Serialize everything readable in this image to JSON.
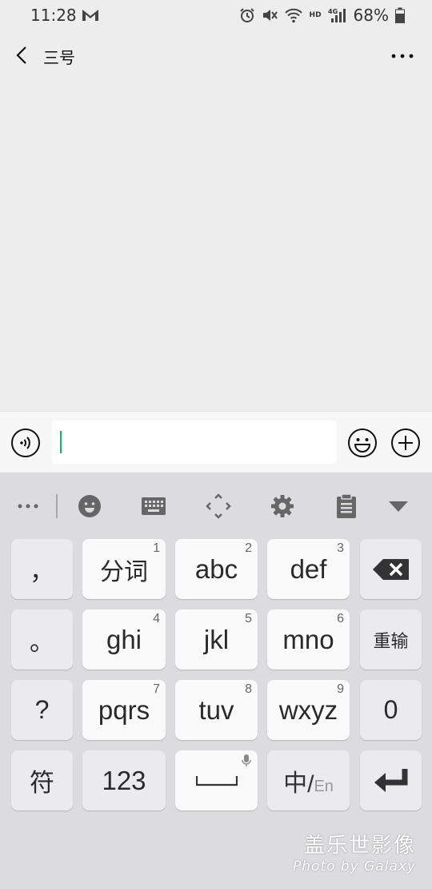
{
  "status_bar": {
    "time": "11:28",
    "battery": "68%",
    "hd_label": "HD",
    "network_label": "4G",
    "icons": [
      "gmail-icon",
      "alarm-icon",
      "mute-icon",
      "wifi-icon",
      "signal-icon",
      "battery-icon"
    ]
  },
  "header": {
    "title": "三号",
    "back_icon": "chevron-left-icon",
    "more_icon": "more-horizontal-icon"
  },
  "input_bar": {
    "value": "",
    "voice_icon": "voice-input-icon",
    "emoji_icon": "emoji-icon",
    "plus_icon": "plus-circle-icon"
  },
  "keyboard": {
    "toolbar_icons": [
      "more-icon",
      "emoji-icon",
      "keyboard-icon",
      "cursor-move-icon",
      "settings-icon",
      "clipboard-icon",
      "collapse-icon"
    ],
    "rows": [
      {
        "left": "，",
        "keys": [
          {
            "label": "分词",
            "num": "1"
          },
          {
            "label": "abc",
            "num": "2"
          },
          {
            "label": "def",
            "num": "3"
          }
        ],
        "right_icon": "backspace-icon"
      },
      {
        "left": "。",
        "keys": [
          {
            "label": "ghi",
            "num": "4"
          },
          {
            "label": "jkl",
            "num": "5"
          },
          {
            "label": "mno",
            "num": "6"
          }
        ],
        "right": "重输"
      },
      {
        "left": "?",
        "keys": [
          {
            "label": "pqrs",
            "num": "7"
          },
          {
            "label": "tuv",
            "num": "8"
          },
          {
            "label": "wxyz",
            "num": "9"
          }
        ],
        "right": "0"
      }
    ],
    "bottom": {
      "symbol": "符",
      "numbers": "123",
      "space_icon": "space-icon",
      "mic_icon": "mic-icon",
      "lang_zh": "中",
      "lang_slash": "/",
      "lang_en": "En",
      "enter_icon": "enter-icon"
    }
  },
  "watermark": {
    "line1": "盖乐世影像",
    "line2": "Photo by Galaxy"
  },
  "colors": {
    "accent": "#07c160",
    "background": "#ededed",
    "keyboard_bg": "#dcdcde",
    "key_bg": "#fafafa"
  }
}
